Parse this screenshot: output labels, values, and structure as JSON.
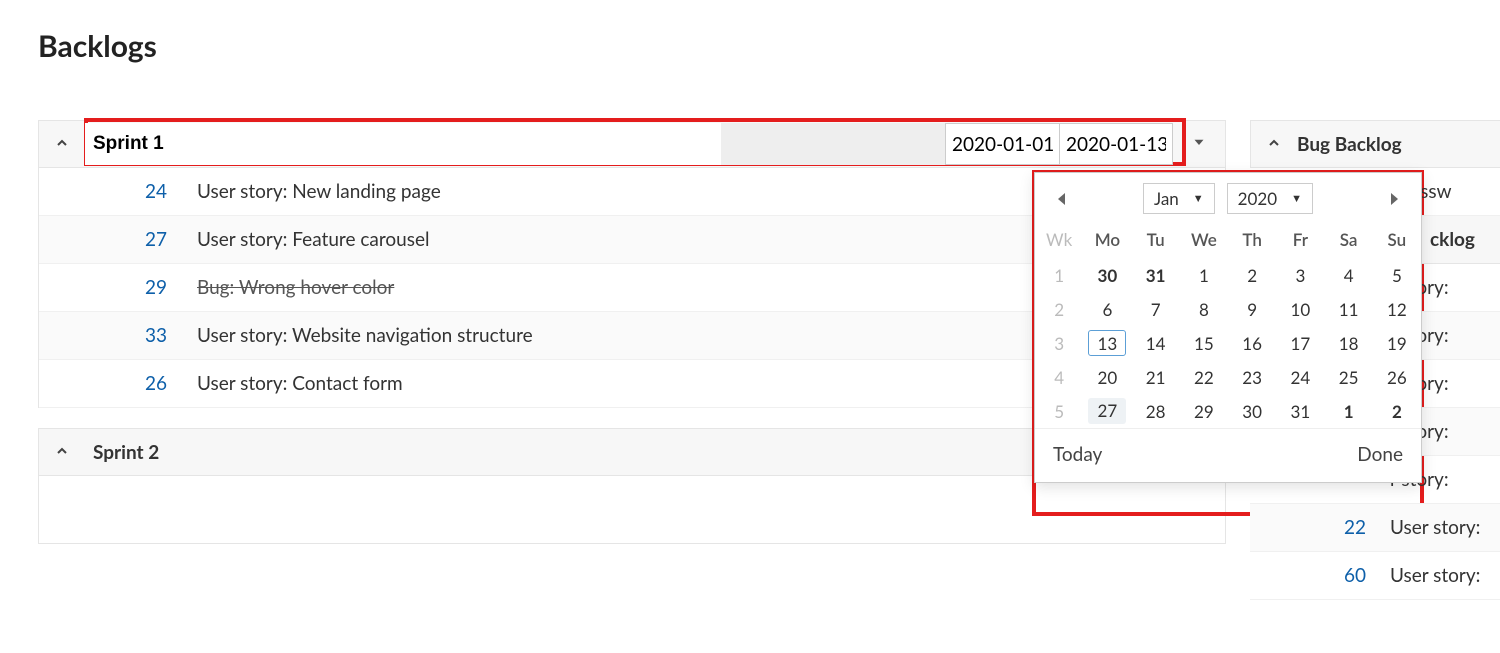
{
  "page": {
    "title": "Backlogs"
  },
  "sprint_edit": {
    "name": "Sprint 1",
    "date_start": "2020-01-01",
    "date_end": "2020-01-13"
  },
  "sprints": [
    {
      "name": "Sprint 1",
      "items": [
        {
          "id": "24",
          "title": "User story: New landing page",
          "done": false
        },
        {
          "id": "27",
          "title": "User story: Feature carousel",
          "done": false
        },
        {
          "id": "29",
          "title": "Bug: Wrong hover color",
          "done": true
        },
        {
          "id": "33",
          "title": "User story: Website navigation structure",
          "done": false
        },
        {
          "id": "26",
          "title": "User story: Contact form",
          "done": false
        }
      ]
    },
    {
      "name": "Sprint 2",
      "items": []
    }
  ],
  "right": {
    "bug_backlog": {
      "title": "Bug Backlog",
      "truncated_item": ": Passw"
    },
    "product_backlog": {
      "title_truncated": "cklog",
      "items": [
        {
          "title": "r story:"
        },
        {
          "title": "r story:"
        },
        {
          "title": "r story:"
        },
        {
          "title": "r story:"
        },
        {
          "title": "r story:"
        },
        {
          "id": "22",
          "title": "User story:"
        },
        {
          "id": "60",
          "title": "User story:"
        }
      ]
    }
  },
  "datepicker": {
    "month": "Jan",
    "year": "2020",
    "today_label": "Today",
    "done_label": "Done",
    "headers": [
      "Wk",
      "Mo",
      "Tu",
      "We",
      "Th",
      "Fr",
      "Sa",
      "Su"
    ],
    "weeks": [
      {
        "wk": "1",
        "days": [
          {
            "d": "30",
            "other": true
          },
          {
            "d": "31",
            "other": true
          },
          {
            "d": "1"
          },
          {
            "d": "2"
          },
          {
            "d": "3"
          },
          {
            "d": "4"
          },
          {
            "d": "5"
          }
        ]
      },
      {
        "wk": "2",
        "days": [
          {
            "d": "6"
          },
          {
            "d": "7"
          },
          {
            "d": "8"
          },
          {
            "d": "9"
          },
          {
            "d": "10"
          },
          {
            "d": "11"
          },
          {
            "d": "12"
          }
        ]
      },
      {
        "wk": "3",
        "days": [
          {
            "d": "13",
            "sel": true
          },
          {
            "d": "14"
          },
          {
            "d": "15"
          },
          {
            "d": "16"
          },
          {
            "d": "17"
          },
          {
            "d": "18"
          },
          {
            "d": "19"
          }
        ]
      },
      {
        "wk": "4",
        "days": [
          {
            "d": "20"
          },
          {
            "d": "21"
          },
          {
            "d": "22"
          },
          {
            "d": "23"
          },
          {
            "d": "24"
          },
          {
            "d": "25"
          },
          {
            "d": "26"
          }
        ]
      },
      {
        "wk": "5",
        "days": [
          {
            "d": "27",
            "shade": true
          },
          {
            "d": "28"
          },
          {
            "d": "29"
          },
          {
            "d": "30"
          },
          {
            "d": "31"
          },
          {
            "d": "1",
            "other": true
          },
          {
            "d": "2",
            "other": true
          }
        ]
      }
    ]
  }
}
